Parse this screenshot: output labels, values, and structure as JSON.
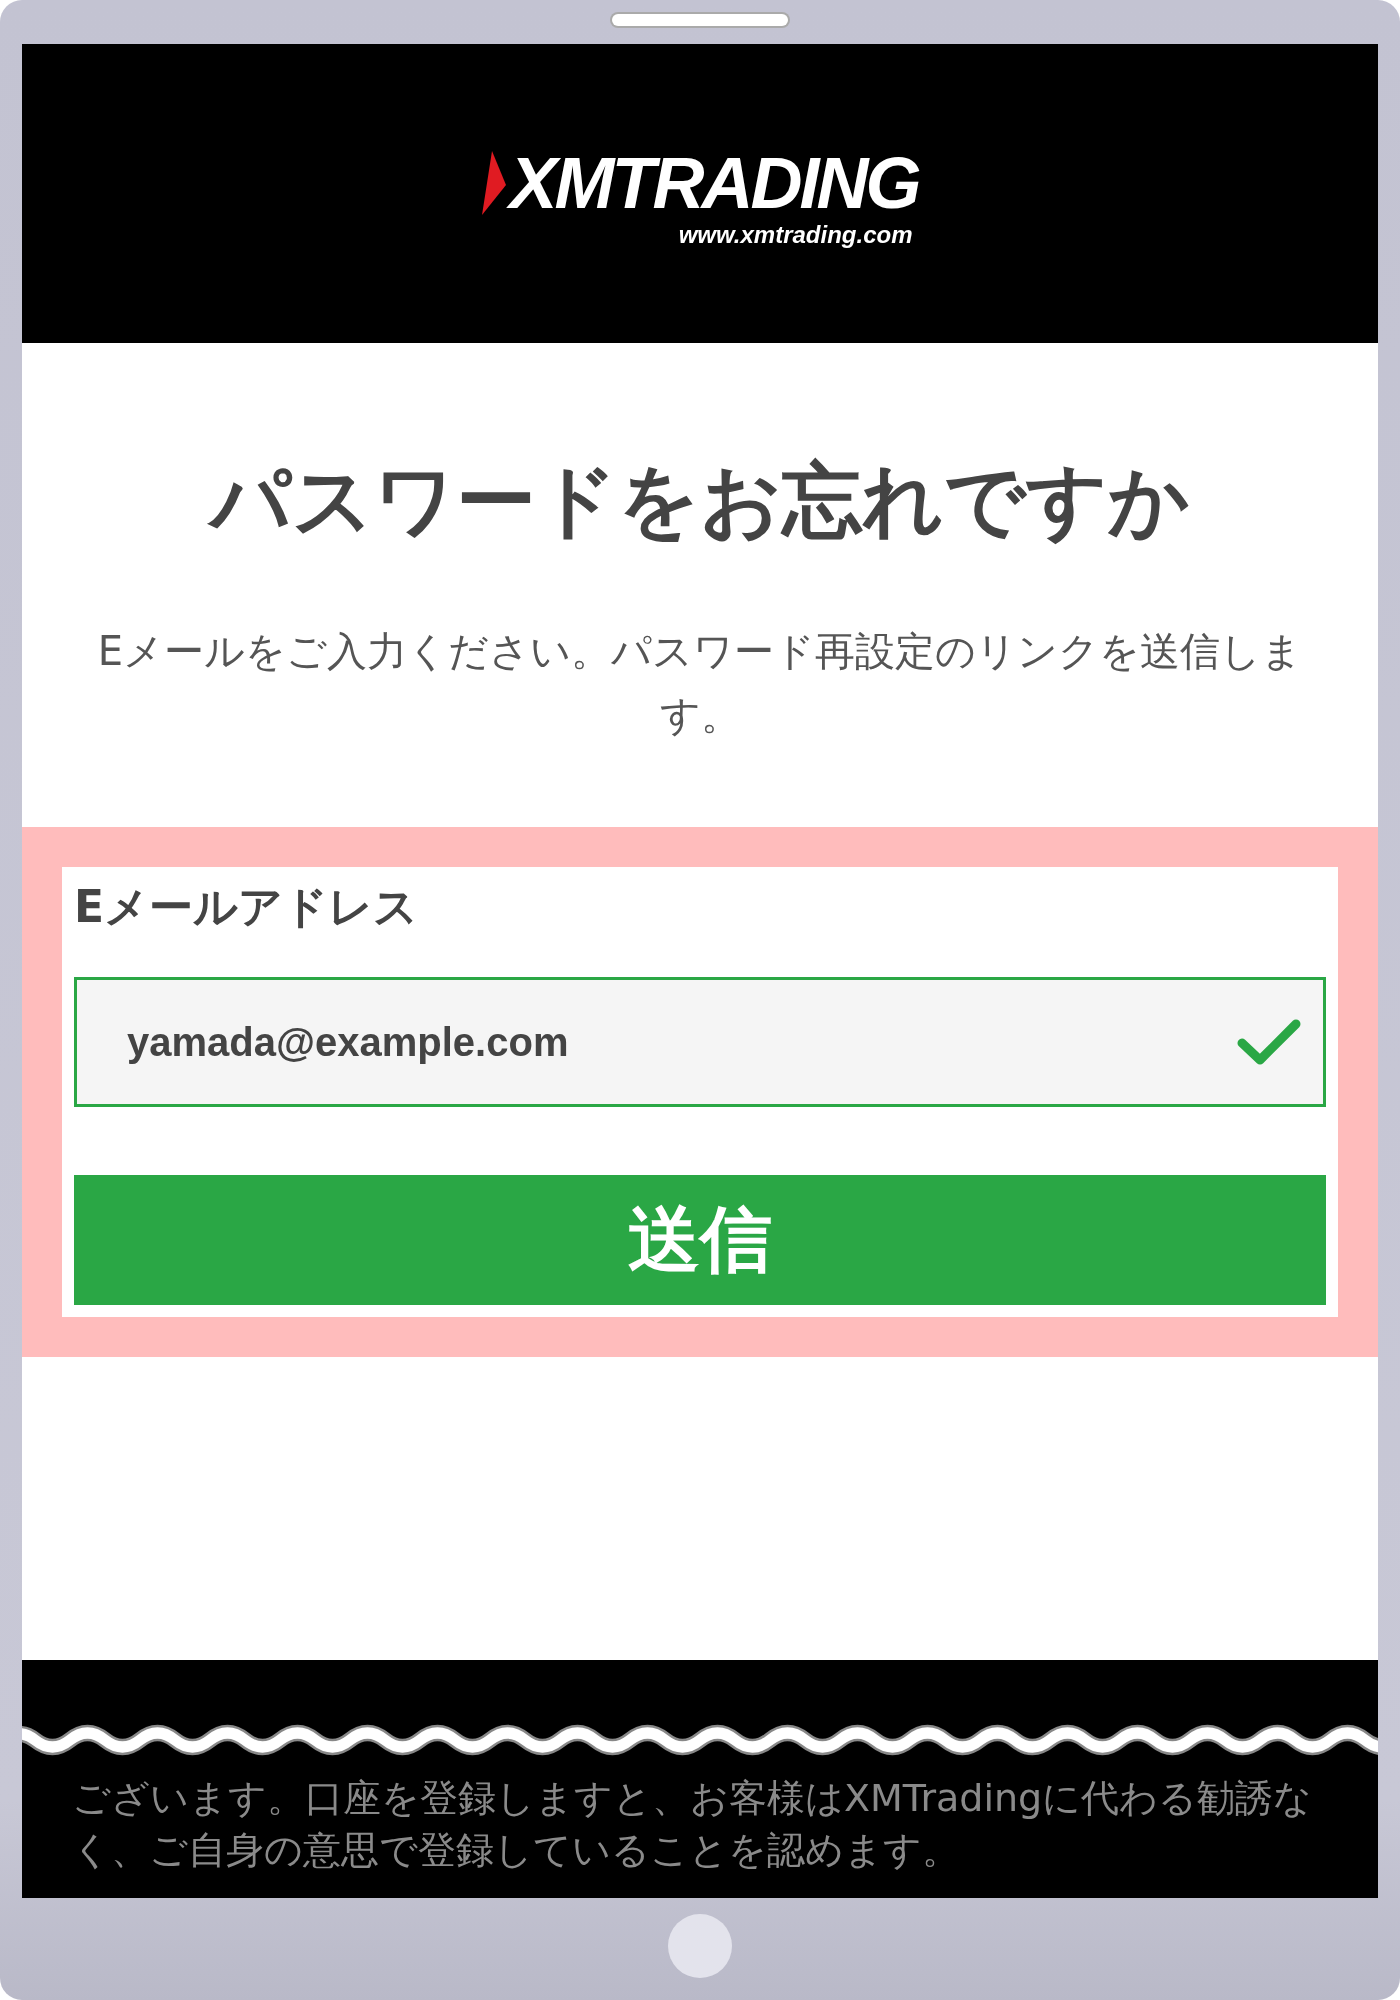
{
  "logo": {
    "name": "XMTRADING",
    "url": "www.xmtrading.com"
  },
  "title": "パスワードをお忘れですか",
  "description": "Eメールをご入力ください。パスワード再設定のリンクを送信します。",
  "form": {
    "label": "Eメールアドレス",
    "email": {
      "value": "yamada@example.com",
      "valid": true
    },
    "submit": "送信"
  },
  "footer": {
    "text": "ございます。口座を登録しますと、お客様はXMTradingに代わる勧誘なく、ご自身の意思で登録していることを認めます。"
  }
}
